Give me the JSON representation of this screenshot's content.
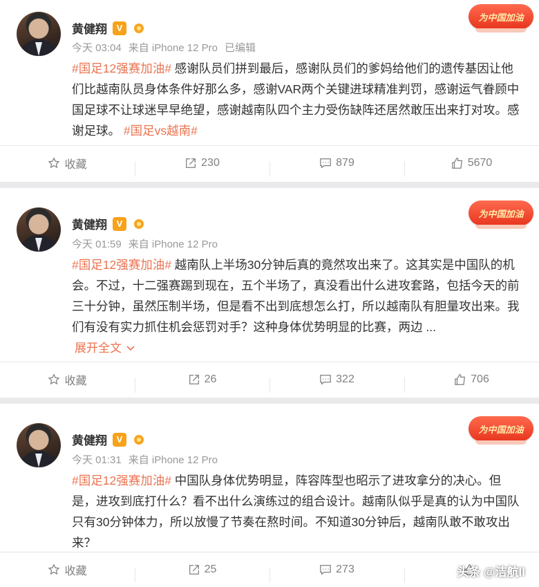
{
  "posts": [
    {
      "author": "黄健翔",
      "v_badge": "V",
      "time": "今天 03:04",
      "source": "来自 iPhone 12 Pro",
      "edited": "已编辑",
      "badge": "为中国加油",
      "tag1": "#国足12强赛加油#",
      "text": " 感谢队员们拼到最后，感谢队员们的爹妈给他们的遗传基因让他们比越南队员身体条件好那么多，感谢VAR两个关键进球精准判罚，感谢运气眷顾中国足球不让球迷早早绝望，感谢越南队四个主力受伤缺阵还居然敢压出来打对攻。感谢足球。 ",
      "tag2": "#国足vs越南#",
      "expand": "",
      "actions": {
        "collect": "收藏",
        "repost": "230",
        "comment": "879",
        "like": "5670"
      }
    },
    {
      "author": "黄健翔",
      "v_badge": "V",
      "time": "今天 01:59",
      "source": "来自 iPhone 12 Pro",
      "edited": "",
      "badge": "为中国加油",
      "tag1": "#国足12强赛加油#",
      "text": " 越南队上半场30分钟后真的竟然攻出来了。这其实是中国队的机会。不过，十二强赛踢到现在，五个半场了，真没看出什么进攻套路，包括今天的前三十分钟，虽然压制半场，但是看不出到底想怎么打，所以越南队有胆量攻出来。我们有没有实力抓住机会惩罚对手？这种身体优势明显的比赛，两边 ...",
      "tag2": "",
      "expand": "展开全文",
      "actions": {
        "collect": "收藏",
        "repost": "26",
        "comment": "322",
        "like": "706"
      }
    },
    {
      "author": "黄健翔",
      "v_badge": "V",
      "time": "今天 01:31",
      "source": "来自 iPhone 12 Pro",
      "edited": "",
      "badge": "为中国加油",
      "tag1": "#国足12强赛加油#",
      "text": " 中国队身体优势明显，阵容阵型也昭示了进攻拿分的决心。但是，进攻到底打什么？看不出什么演练过的组合设计。越南队似乎是真的认为中国队只有30分钟体力，所以放慢了节奏在熬时间。不知道30分钟后，越南队敢不敢攻出来？",
      "tag2": "",
      "expand": "",
      "actions": {
        "collect": "收藏",
        "repost": "25",
        "comment": "273",
        "like": ""
      }
    }
  ],
  "watermark": "头条 @洁航ll",
  "colors": {
    "accent": "#eb7350",
    "muted": "#808080",
    "separator": "#eaeaec"
  }
}
